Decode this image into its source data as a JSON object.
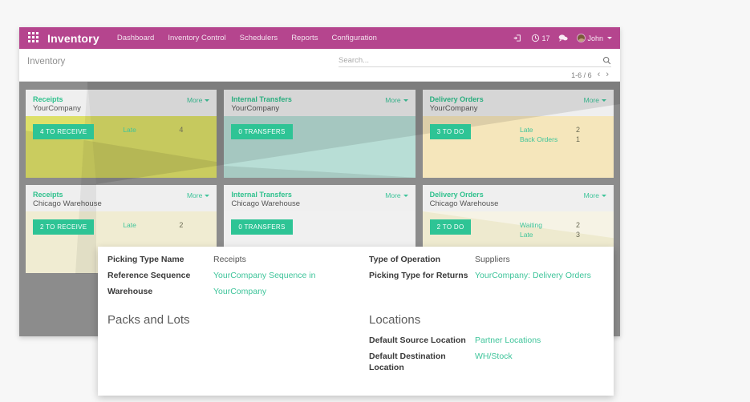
{
  "topbar": {
    "app_title": "Inventory",
    "apps_icon": "apps-grid-icon",
    "menu": [
      {
        "label": "Dashboard"
      },
      {
        "label": "Inventory Control"
      },
      {
        "label": "Schedulers"
      },
      {
        "label": "Reports"
      },
      {
        "label": "Configuration"
      }
    ],
    "right": {
      "signin_icon": "sign-in-icon",
      "activity_icon": "clock-icon",
      "activity_count": "17",
      "messages_icon": "chat-bubble-icon",
      "avatar_icon": "user-avatar",
      "user_name": "John",
      "user_caret": "chevron-down-icon"
    },
    "accent_purple": "#b5458e"
  },
  "control_panel": {
    "breadcrumb": "Inventory",
    "search_placeholder": "Search...",
    "search_value": "",
    "search_icon": "search-icon",
    "pager_text": "1-6 / 6",
    "pager_prev": "‹",
    "pager_next": "›"
  },
  "board": {
    "more_label": "More",
    "rows": [
      {
        "cards": [
          {
            "title": "Receipts",
            "subtitle": "YourCompany",
            "button": "4 TO RECEIVE",
            "stats": [
              {
                "label": "Late",
                "value": "4"
              }
            ]
          },
          {
            "title": "Internal Transfers",
            "subtitle": "YourCompany",
            "button": "0 TRANSFERS",
            "stats": []
          },
          {
            "title": "Delivery Orders",
            "subtitle": "YourCompany",
            "button": "3 TO DO",
            "stats": [
              {
                "label": "Late",
                "value": "2"
              },
              {
                "label": "Back Orders",
                "value": "1"
              }
            ]
          }
        ]
      },
      {
        "cards": [
          {
            "title": "Receipts",
            "subtitle": "Chicago Warehouse",
            "button": "2 TO RECEIVE",
            "stats": [
              {
                "label": "Late",
                "value": "2"
              }
            ]
          },
          {
            "title": "Internal Transfers",
            "subtitle": "Chicago Warehouse",
            "button": "0 TRANSFERS",
            "stats": []
          },
          {
            "title": "Delivery Orders",
            "subtitle": "Chicago Warehouse",
            "button": "2 TO DO",
            "stats": [
              {
                "label": "Waiting",
                "value": "2"
              },
              {
                "label": "Late",
                "value": "3"
              }
            ]
          }
        ]
      }
    ],
    "colors": {
      "board_bg": "#8c8c8c",
      "card_yellow": "#dde069",
      "card_teal": "#b8ded6",
      "card_cream": "#f5e6bb",
      "accent_teal": "#2ec495"
    }
  },
  "detail_panel": {
    "left_fields": [
      {
        "label": "Picking Type Name",
        "value": "Receipts",
        "is_link": false
      },
      {
        "label": "Reference Sequence",
        "value": "YourCompany Sequence in",
        "is_link": true
      },
      {
        "label": "Warehouse",
        "value": "YourCompany",
        "is_link": true
      }
    ],
    "right_fields": [
      {
        "label": "Type of Operation",
        "value": "Suppliers",
        "is_link": false
      },
      {
        "label": "Picking Type for Returns",
        "value": "YourCompany: Delivery Orders",
        "is_link": true
      }
    ],
    "section_left_title": "Packs and Lots",
    "section_right_title": "Locations",
    "location_fields": [
      {
        "label": "Default Source Location",
        "value": "Partner Locations",
        "is_link": true
      },
      {
        "label": "Default Destination Location",
        "value": "WH/Stock",
        "is_link": true
      }
    ]
  }
}
